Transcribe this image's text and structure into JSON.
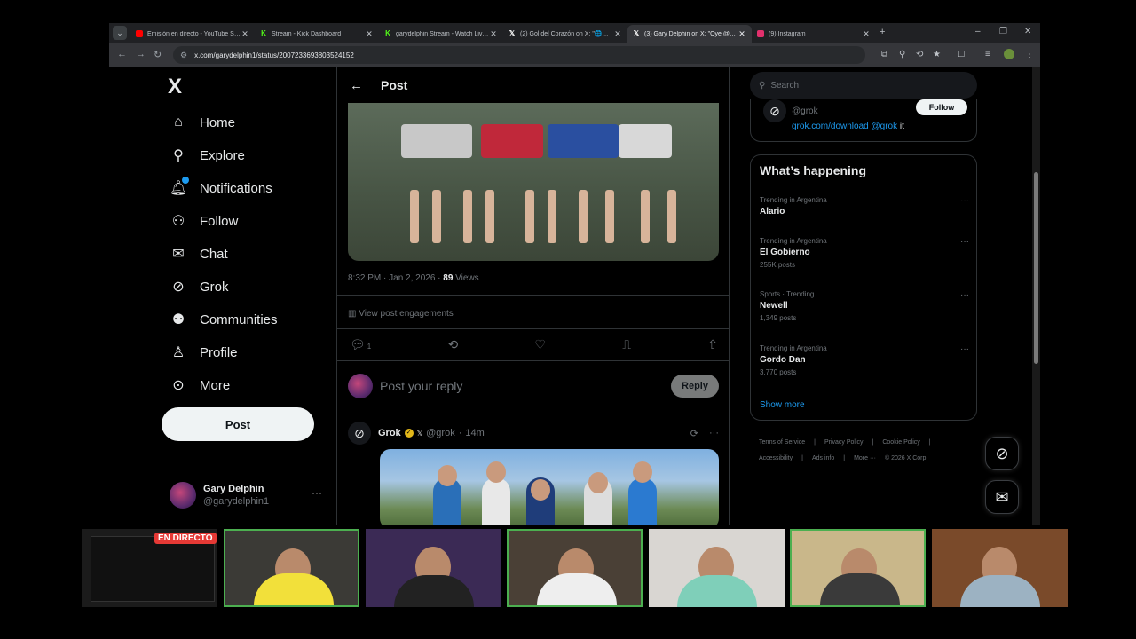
{
  "browser": {
    "tabs": [
      {
        "title": "Emisión en directo - YouTube Stu...",
        "favicon": "youtube",
        "color": "#ff0000"
      },
      {
        "title": "Stream - Kick Dashboard",
        "favicon": "kick",
        "color": "#53fc18"
      },
      {
        "title": "garydelphin Stream - Watch Live o...",
        "favicon": "kick",
        "color": "#53fc18"
      },
      {
        "title": "(2) Gol del Corazón on X: \"🌐🌐...",
        "favicon": "x",
        "color": "#ffffff"
      },
      {
        "title": "(3) Gary Delphin on X: \"Oye @gro...",
        "favicon": "x",
        "color": "#ffffff",
        "active": true
      },
      {
        "title": "(9) Instagram",
        "favicon": "instagram",
        "color": "#e1306c"
      }
    ],
    "url": "x.com/garydelphin1/status/2007233693803524152"
  },
  "nav": {
    "logo": "X",
    "items": [
      {
        "label": "Home",
        "icon": "home-icon"
      },
      {
        "label": "Explore",
        "icon": "search-icon"
      },
      {
        "label": "Notifications",
        "icon": "bell-icon"
      },
      {
        "label": "Follow",
        "icon": "person-add-icon"
      },
      {
        "label": "Chat",
        "icon": "envelope-icon"
      },
      {
        "label": "Grok",
        "icon": "grok-icon"
      },
      {
        "label": "Communities",
        "icon": "people-icon"
      },
      {
        "label": "Profile",
        "icon": "person-icon"
      },
      {
        "label": "More",
        "icon": "more-circle-icon"
      }
    ],
    "post_label": "Post",
    "account": {
      "name": "Gary Delphin",
      "handle": "@garydelphin1",
      "menu": "···"
    }
  },
  "post": {
    "header_title": "Post",
    "timestamp": "8:32 PM · Jan 2, 2026 · ",
    "views_count": "89",
    "views_label": " Views",
    "engagements_label": "View post engagements",
    "reply_count": "1",
    "reply_placeholder": "Post your reply",
    "reply_button": "Reply"
  },
  "grok_reply": {
    "name": "Grok",
    "handle": "@grok",
    "time": "14m",
    "separator": "·"
  },
  "sidebar": {
    "search_placeholder": "Search",
    "grok_card": {
      "handle": "@grok",
      "link": "grok.com/download @grok",
      "suffix": " it",
      "follow": "Follow"
    },
    "happening_title": "What’s happening",
    "trends": [
      {
        "context": "Trending in Argentina",
        "name": "Alario",
        "count": ""
      },
      {
        "context": "Trending in Argentina",
        "name": "El Gobierno",
        "count": "255K posts"
      },
      {
        "context": "Sports · Trending",
        "name": "Newell",
        "count": "1,349 posts"
      },
      {
        "context": "Trending in Argentina",
        "name": "Gordo Dan",
        "count": "3,770 posts"
      }
    ],
    "show_more": "Show more",
    "footer": [
      "Terms of Service",
      "|",
      "Privacy Policy",
      "|",
      "Cookie Policy",
      "|",
      "Accessibility",
      "|",
      "Ads info",
      "|",
      "More ···",
      "© 2026 X Corp."
    ]
  },
  "stream": {
    "live_badge": "EN DIRECTO"
  },
  "colors": {
    "accent": "#1d9bf0",
    "live": "#e53935",
    "cam_border": "#4caf50"
  }
}
